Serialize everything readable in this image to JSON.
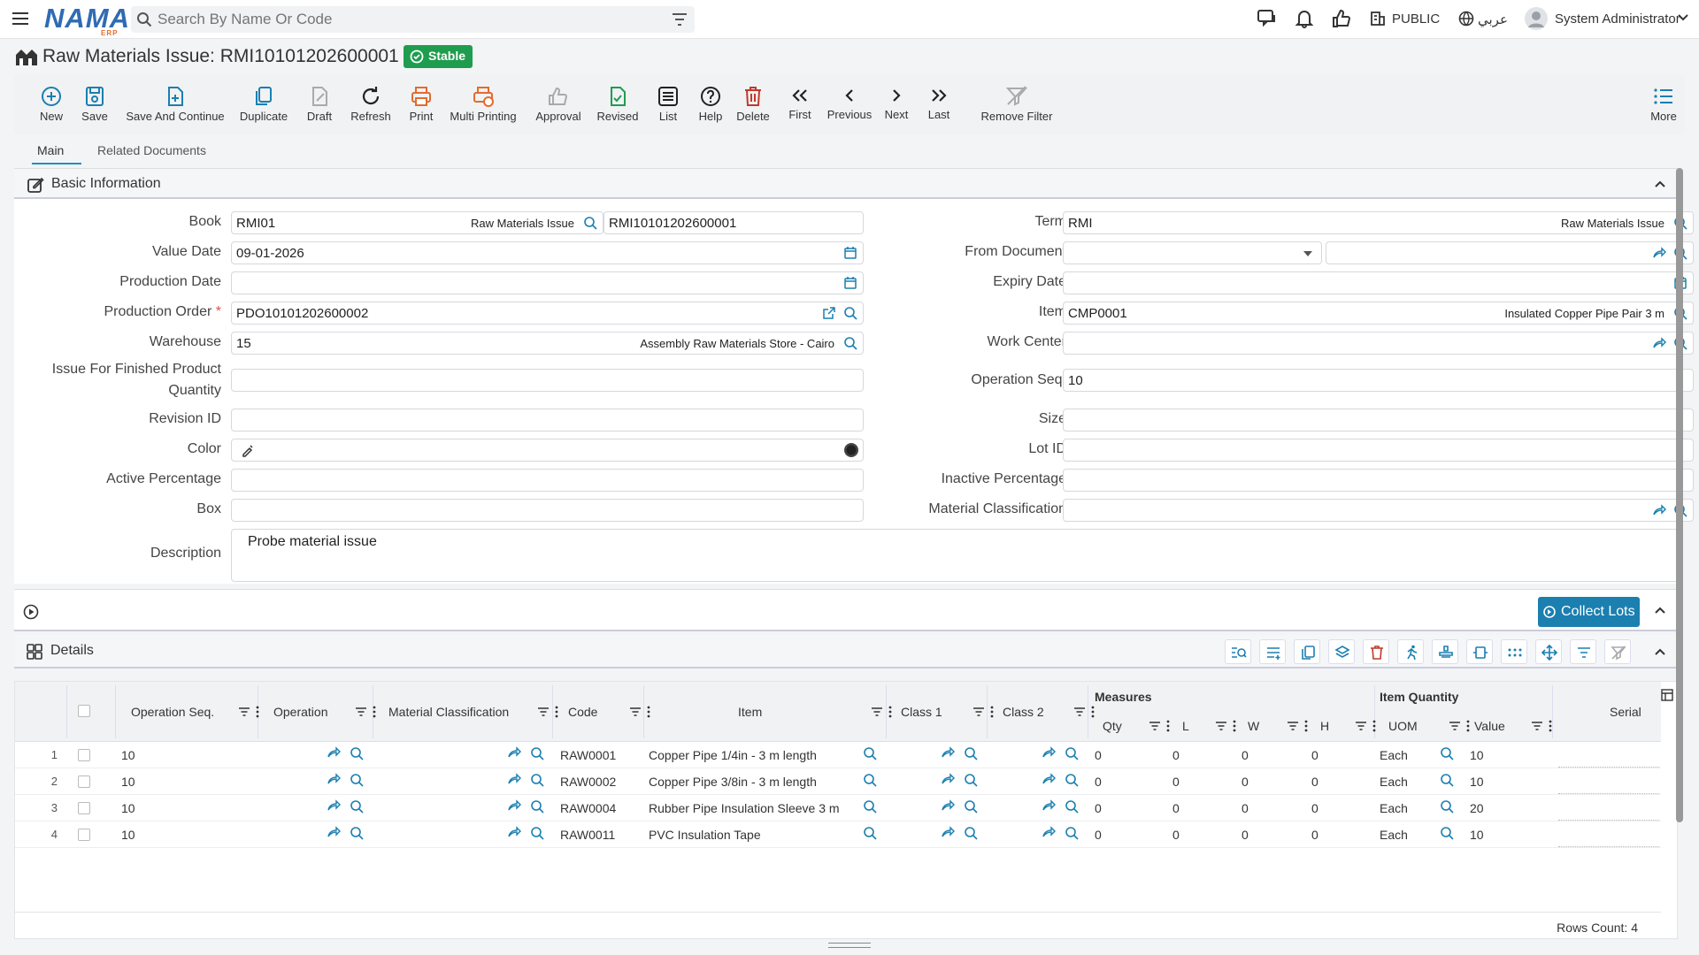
{
  "app": {
    "logo": "NAMA",
    "logo_sub": "ERP"
  },
  "search": {
    "placeholder": "Search By Name Or Code"
  },
  "topbar": {
    "public_label": "PUBLIC",
    "lang_label": "عربي",
    "user_name": "System Administrator"
  },
  "page": {
    "title": "Raw Materials Issue: RMI10101202600001",
    "status_badge": "Stable"
  },
  "toolbar": {
    "new": "New",
    "save": "Save",
    "save_continue": "Save And Continue",
    "duplicate": "Duplicate",
    "draft": "Draft",
    "refresh": "Refresh",
    "print": "Print",
    "multi_printing": "Multi Printing",
    "approval": "Approval",
    "revised": "Revised",
    "list": "List",
    "help": "Help",
    "delete": "Delete",
    "first": "First",
    "previous": "Previous",
    "next": "Next",
    "last": "Last",
    "remove_filter": "Remove Filter",
    "more": "More"
  },
  "tabs": {
    "main": "Main",
    "related": "Related Documents"
  },
  "basic": {
    "section_title": "Basic Information",
    "book_label": "Book",
    "book_code": "RMI01",
    "book_name": "Raw Materials Issue",
    "book_number": "RMI10101202600001",
    "value_date_label": "Value Date",
    "value_date": "09-01-2026",
    "production_date_label": "Production Date",
    "production_order_label": "Production Order",
    "production_order": "PDO10101202600002",
    "warehouse_label": "Warehouse",
    "warehouse_code": "15",
    "warehouse_name": "Assembly Raw Materials Store - Cairo",
    "issue_qty_label_1": "Issue For Finished Product",
    "issue_qty_label_2": "Quantity",
    "revision_label": "Revision ID",
    "color_label": "Color",
    "active_pct_label": "Active Percentage",
    "box_label": "Box",
    "description_label": "Description",
    "description": "Probe material issue",
    "term_label": "Term",
    "term_code": "RMI",
    "term_name": "Raw Materials Issue",
    "from_doc_label": "From Document",
    "expiry_label": "Expiry Date",
    "item_label": "Item",
    "item_code": "CMP0001",
    "item_name": "Insulated Copper Pipe Pair 3 m",
    "work_center_label": "Work Center",
    "op_seq_label": "Operation Seq.",
    "op_seq": "10",
    "size_label": "Size",
    "lot_label": "Lot ID",
    "inactive_pct_label": "Inactive Percentage",
    "mat_class_label": "Material Classification",
    "required_mark": "*"
  },
  "collect_lots": "Collect Lots",
  "details": {
    "title": "Details",
    "group_measures": "Measures",
    "group_item_qty": "Item Quantity",
    "columns": {
      "op_seq": "Operation Seq.",
      "operation": "Operation",
      "mat_class": "Material Classification",
      "code": "Code",
      "item": "Item",
      "class1": "Class 1",
      "class2": "Class 2",
      "qty": "Qty",
      "l": "L",
      "w": "W",
      "h": "H",
      "uom": "UOM",
      "value": "Value",
      "serial": "Serial"
    },
    "rows": [
      {
        "n": "1",
        "op_seq": "10",
        "code": "RAW0001",
        "item": "Copper Pipe 1/4in - 3 m length",
        "qty": "0",
        "l": "0",
        "w": "0",
        "h": "0",
        "uom": "Each",
        "value": "10"
      },
      {
        "n": "2",
        "op_seq": "10",
        "code": "RAW0002",
        "item": "Copper Pipe 3/8in - 3 m length",
        "qty": "0",
        "l": "0",
        "w": "0",
        "h": "0",
        "uom": "Each",
        "value": "10"
      },
      {
        "n": "3",
        "op_seq": "10",
        "code": "RAW0004",
        "item": "Rubber Pipe Insulation Sleeve 3 m",
        "qty": "0",
        "l": "0",
        "w": "0",
        "h": "0",
        "uom": "Each",
        "value": "20"
      },
      {
        "n": "4",
        "op_seq": "10",
        "code": "RAW0011",
        "item": "PVC Insulation Tape",
        "qty": "0",
        "l": "0",
        "w": "0",
        "h": "0",
        "uom": "Each",
        "value": "10"
      }
    ],
    "rows_count": "Rows Count: 4"
  },
  "colors": {
    "accent": "#1b7fb0",
    "stable": "#1f9d4e",
    "print": "#e36b2c",
    "delete": "#c0392b",
    "revised": "#1f9d4e"
  }
}
